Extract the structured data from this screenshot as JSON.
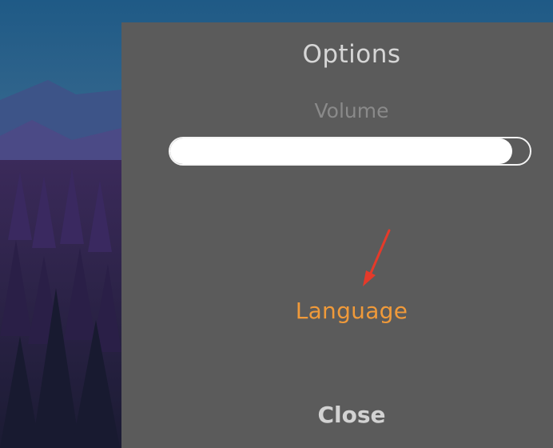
{
  "options_menu": {
    "title": "Options",
    "volume_label": "Volume",
    "volume_level": 0.95,
    "language_label": "Language",
    "close_label": "Close"
  },
  "colors": {
    "panel_background": "#5b5b5b",
    "title_text": "#d6d6d6",
    "volume_label_text": "#8a8a8a",
    "slider_fill": "#ffffff",
    "language_text": "#f09a3a",
    "close_text": "#d2d2d2",
    "annotation_arrow": "#e53a2a"
  }
}
